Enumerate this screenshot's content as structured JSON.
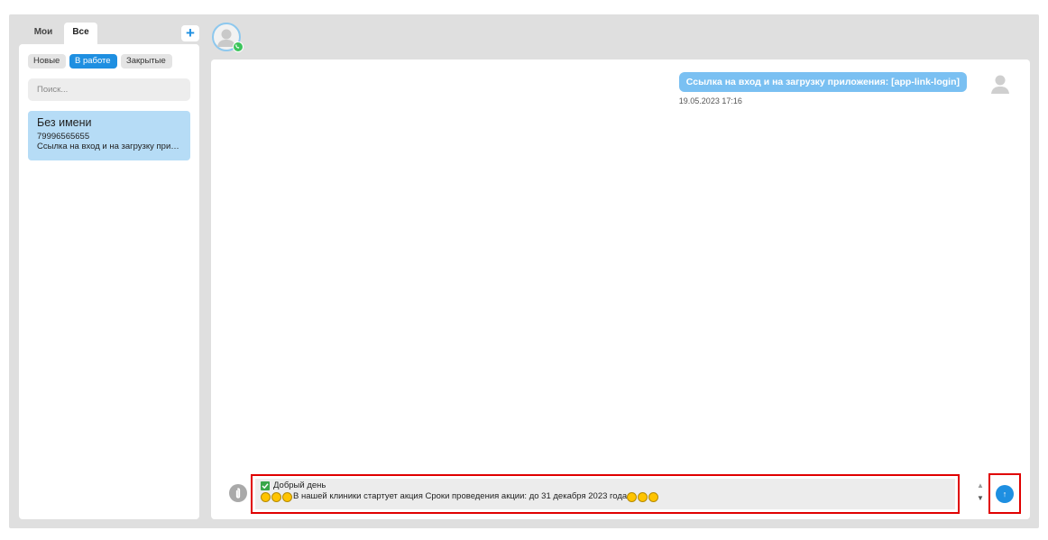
{
  "sidebar": {
    "tabs": [
      {
        "label": "Мои",
        "active": false
      },
      {
        "label": "Все",
        "active": true
      }
    ],
    "add_label": "+",
    "filters": [
      {
        "label": "Новые",
        "active": false
      },
      {
        "label": "В работе",
        "active": true
      },
      {
        "label": "Закрытые",
        "active": false
      }
    ],
    "search_placeholder": "Поиск...",
    "contacts": [
      {
        "name": "Без имени",
        "phone": "79996565655",
        "preview": "Ссылка на вход и на загрузку приложения: [app-link-login]"
      }
    ]
  },
  "header": {
    "channel_icon": "whatsapp-icon"
  },
  "chat": {
    "messages": [
      {
        "text": "Ссылка на вход и на загрузку приложения: [app-link-login]",
        "time": "19.05.2023 17:16",
        "direction": "outgoing"
      }
    ]
  },
  "composer": {
    "line1": "Добрый день",
    "line2": "В нашей клиники стартует акция Сроки проведения акции: до 31 декабря 2023 года",
    "send_label": "↑"
  },
  "colors": {
    "accent": "#1e8fe1",
    "bubble": "#7ac0f2",
    "contact_selected": "#b6dcf6",
    "highlight": "#e00000"
  }
}
